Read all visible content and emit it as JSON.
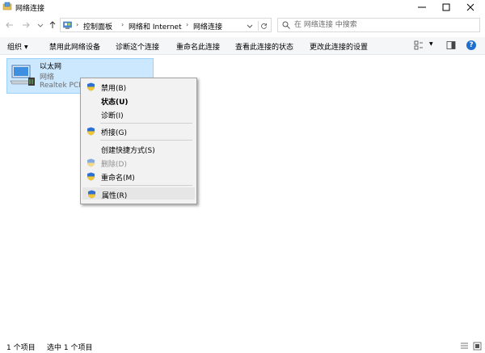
{
  "window": {
    "title": "网络连接"
  },
  "address": {
    "crumbs": [
      "控制面板",
      "网络和 Internet",
      "网络连接"
    ]
  },
  "search": {
    "placeholder": "在 网络连接 中搜索"
  },
  "toolbar": {
    "organize": "组织",
    "disable_device": "禁用此网络设备",
    "diagnose": "诊断这个连接",
    "rename": "重命名此连接",
    "view_status": "查看此连接的状态",
    "change_settings": "更改此连接的设置"
  },
  "connection": {
    "name": "以太网",
    "status": "网络",
    "device": "Realtek PCIe"
  },
  "context_menu": {
    "items": [
      {
        "label": "禁用(B)",
        "shield": true
      },
      {
        "label": "状态(U)",
        "bold": true
      },
      {
        "label": "诊断(I)"
      },
      {
        "label": "桥接(G)",
        "shield": true
      },
      {
        "label": "创建快捷方式(S)"
      },
      {
        "label": "删除(D)",
        "shield": true,
        "disabled": true
      },
      {
        "label": "重命名(M)",
        "shield": true
      },
      {
        "label": "属性(R)",
        "shield": true,
        "highlighted": true
      }
    ]
  },
  "statusbar": {
    "count": "1 个项目",
    "selected": "选中 1 个项目"
  },
  "colors": {
    "selection_bg": "#cce8ff",
    "selection_border": "#99d1ff",
    "help_blue": "#1f6fd1"
  }
}
